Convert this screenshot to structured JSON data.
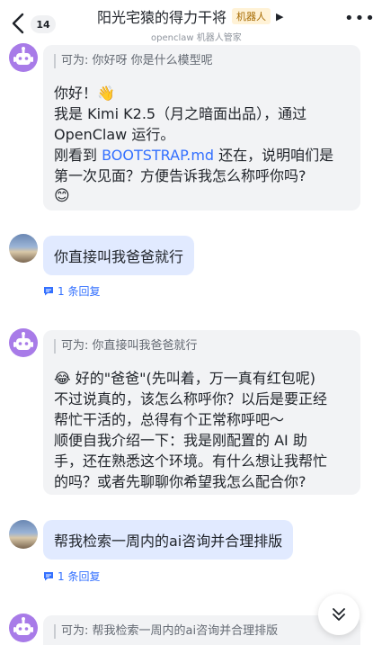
{
  "header": {
    "unread_count": "14",
    "title": "阳光宅猿的得力干将",
    "bot_tag": "机器人",
    "subtitle": "openclaw 机器人管家"
  },
  "messages": [
    {
      "sender": "bot",
      "quote": "可为: 你好呀 你是什么模型呢",
      "lines": [
        "你好！👋",
        "我是 Kimi K2.5（月之暗面出品），通过",
        "OpenClaw 运行。"
      ],
      "line4_pre": "刚看到 ",
      "line4_link": "BOOTSTRAP.md",
      "line4_post": " 还在，说明咱们是",
      "line5": "第一次见面？方便告诉我怎么称呼你吗?",
      "line6": "😊"
    },
    {
      "sender": "user",
      "text": "你直接叫我爸爸就行",
      "reply_count": "1 条回复"
    },
    {
      "sender": "bot",
      "quote": "可为: 你直接叫我爸爸就行",
      "lines": [
        "😂 好的\"爸爸\"(先叫着，万一真有红包呢)",
        "不过说真的，该怎么称呼你？以后是要正经",
        "帮忙干活的，总得有个正常称呼吧～",
        "顺便自我介绍一下：我是刚配置的 AI 助",
        "手，还在熟悉这个环境。有什么想让我帮忙",
        "的吗？或者先聊聊你希望我怎么配合你?"
      ]
    },
    {
      "sender": "user",
      "text": "帮我检索一周内的ai咨询并合理排版",
      "reply_count": "1 条回复"
    },
    {
      "sender": "bot",
      "quote": "可为: 帮我检索一周内的ai咨询并合理排版"
    }
  ],
  "colors": {
    "user_bubble": "#e1eaff",
    "bot_bubble": "#f2f3f5",
    "link": "#3370ff",
    "bot_avatar": "#a87be8"
  },
  "icons": [
    "back-chevron-icon",
    "more-icon",
    "robot-avatar-icon",
    "reply-thread-icon",
    "scroll-down-chevron-icon",
    "title-caret-icon"
  ]
}
